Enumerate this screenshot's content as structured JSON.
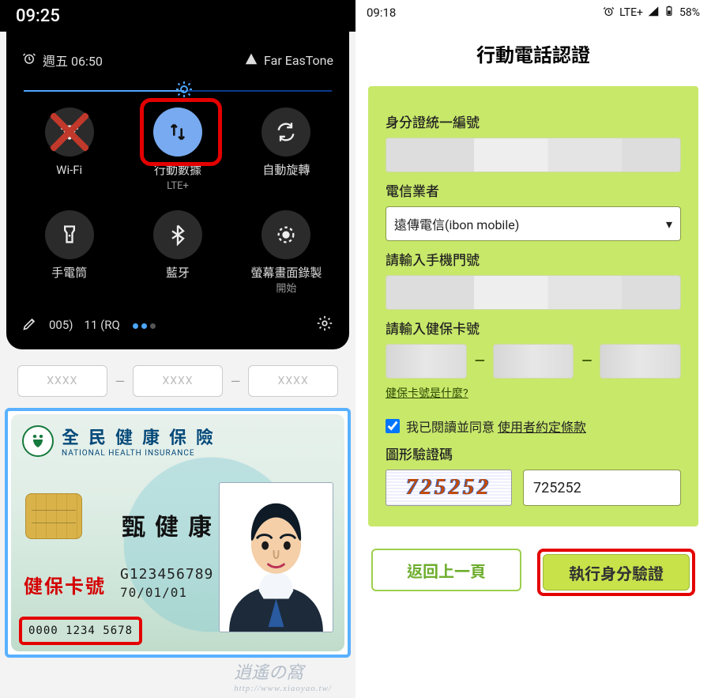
{
  "left": {
    "status_time": "09:25",
    "alarm_text": "週五 06:50",
    "carrier": "Far EasTone",
    "tiles": [
      {
        "label": "Wi-Fi"
      },
      {
        "label": "行動數據",
        "sublabel": "LTE+"
      },
      {
        "label": "自動旋轉"
      },
      {
        "label": "手電筒"
      },
      {
        "label": "藍牙"
      },
      {
        "label": "螢幕畫面錄製",
        "sublabel": "開始"
      }
    ],
    "footer_build_a": "005)",
    "footer_build_b": "11 (RQ",
    "bg_placeholder": "XXXX",
    "card": {
      "title_zh": "全民健康保險",
      "title_en": "NATIONAL HEALTH INSURANCE",
      "name": "甄健康",
      "id_number": "G123456789",
      "dob": "70/01/01",
      "red_label": "健保卡號",
      "serial": "0000 1234 5678"
    }
  },
  "right": {
    "status_time": "09:18",
    "status_net": "LTE+",
    "status_batt": "58%",
    "page_title": "行動電話認證",
    "labels": {
      "id": "身分證統一編號",
      "carrier": "電信業者",
      "phone": "請輸入手機門號",
      "nhi": "請輸入健保卡號",
      "captcha": "圖形驗證碼"
    },
    "carrier_value": "遠傳電信(ibon mobile)",
    "nhi_hint": "健保卡號是什麼?",
    "agree_text": "我已閱讀並同意",
    "agree_link": "使用者約定條款",
    "captcha_image_text": "725252",
    "captcha_input_value": "725252",
    "btn_back": "返回上一頁",
    "btn_go": "執行身分驗證"
  }
}
